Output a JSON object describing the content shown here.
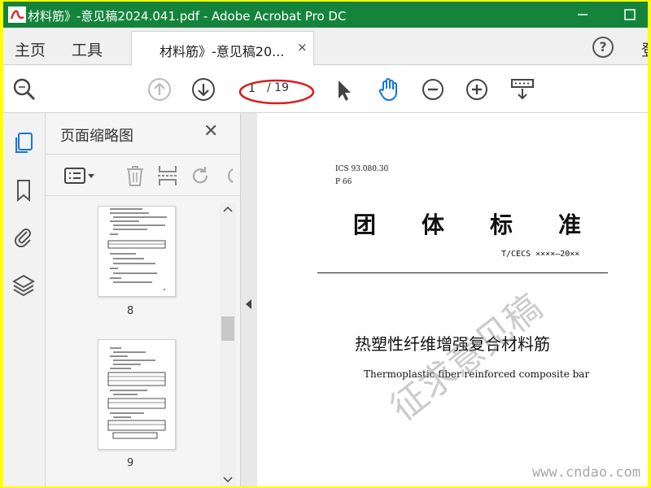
{
  "window": {
    "title": "材料筋》-意见稿2024.041.pdf - Adobe Acrobat Pro DC",
    "app_icon": "acrobat-logo",
    "title_color": "#14843c",
    "frame_color": "#ffff00"
  },
  "nav": {
    "home_label": "主页",
    "tools_label": "工具",
    "tab_label": "材料筋》-意见稿20...",
    "tab_close": "×",
    "help_label": "?",
    "sign_label": "登"
  },
  "toolbar": {
    "current_page": "1",
    "total_pages": "/ 19",
    "icons": [
      "search-icon",
      "page-up-icon",
      "page-down-icon",
      "select-cursor-icon",
      "hand-tool-icon",
      "zoom-out-icon",
      "zoom-in-icon",
      "more-tools-icon"
    ]
  },
  "panel": {
    "title": "页面缩略图",
    "close": "✕",
    "thumbnails": [
      {
        "page": "8"
      },
      {
        "page": "9"
      }
    ]
  },
  "document": {
    "ics": "ICS 93.080.30",
    "p_code": "P 66",
    "title_chars": [
      "团",
      "体",
      "标",
      "准"
    ],
    "standard_code": "T/CECS ××××—20××",
    "chinese_title": "热塑性纤维增强复合材料筋",
    "english_title": "Thermoplastic fiber reinforced composite bar",
    "watermark": "征求意见稿",
    "site_watermark": "www.cndao.com"
  }
}
